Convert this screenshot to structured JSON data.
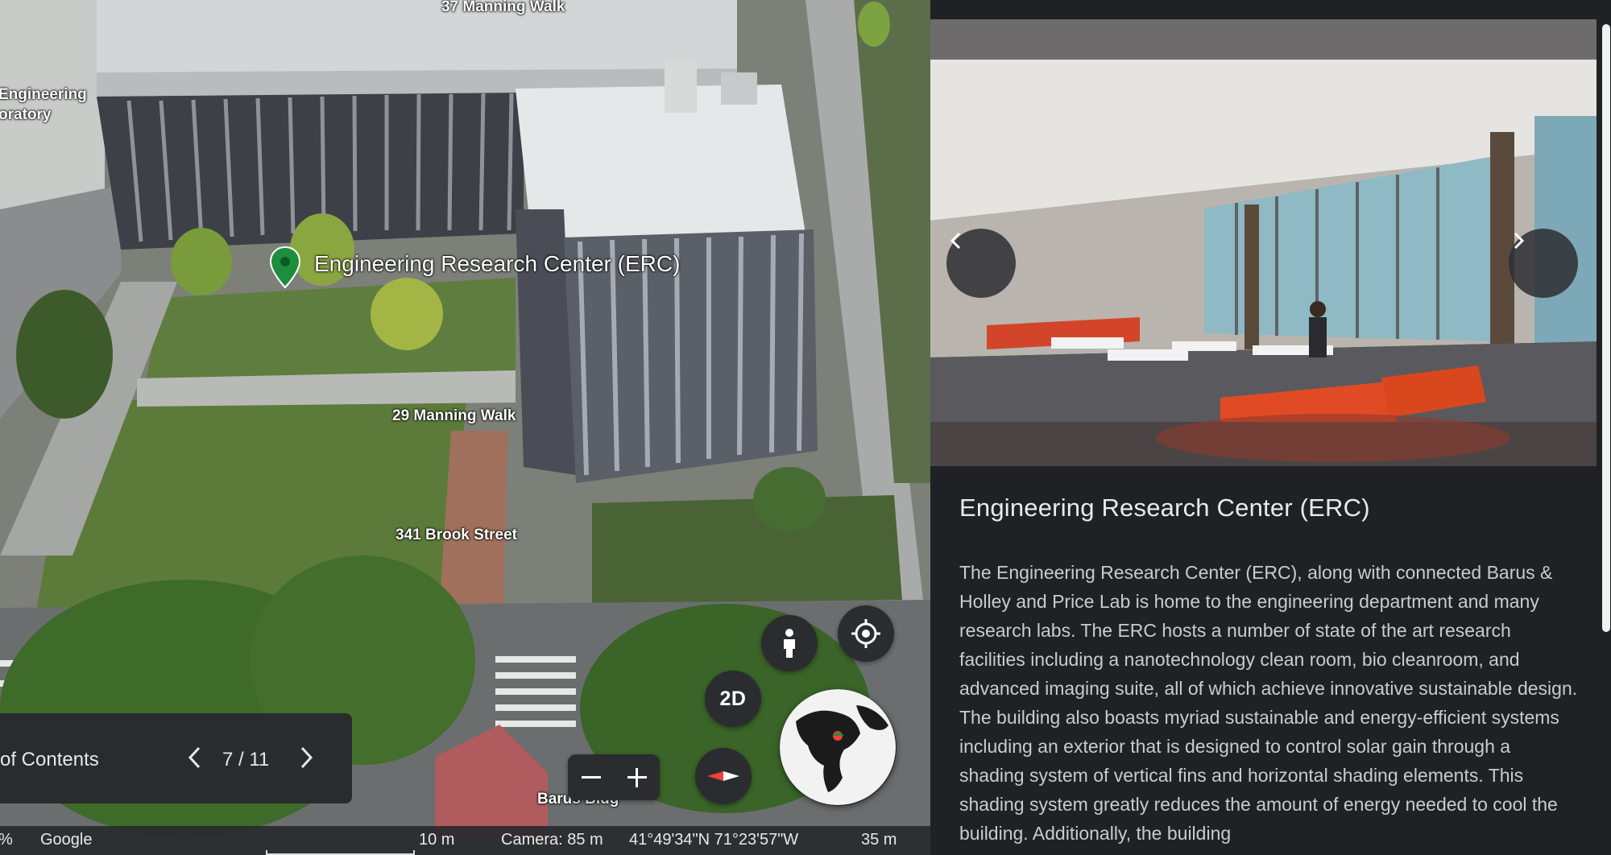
{
  "map": {
    "labels": {
      "top_street": "37 Manning Walk",
      "lab_line1": "Engineering",
      "lab_line2": "oratory",
      "poi": "Engineering Research Center (ERC)",
      "walk_29": "29 Manning Walk",
      "brook_341": "341 Brook Street",
      "barus": "Barus Bldg"
    },
    "controls": {
      "pegman_icon": "person-icon",
      "locate_icon": "my-location-icon",
      "view_toggle": "2D",
      "zoom_out_icon": "minus-icon",
      "zoom_in_icon": "plus-icon",
      "compass_icon": "compass-icon",
      "globe_icon": "globe-icon"
    },
    "colors": {
      "pin": "#1e8e3e",
      "compass_red": "#ea4335",
      "control_bg": "#2b2c2f"
    }
  },
  "toc": {
    "label": "of Contents",
    "count": "7 / 11"
  },
  "statusbar": {
    "zoom_pct": "%",
    "attribution": "Google",
    "scale": "10 m",
    "camera": "Camera: 85 m",
    "coords": "41°49'34\"N 71°23'57\"W",
    "elevation": "35 m"
  },
  "panel": {
    "title": "Engineering Research Center (ERC)",
    "description": "The Engineering Research Center (ERC), along with connected Barus & Holley and Price Lab is home to the engineering department and many research labs. The ERC hosts a number of state of the art research facilities including a nanotechnology clean room, bio cleanroom, and advanced imaging suite, all of which achieve innovative sustainable design. The building also boasts myriad sustainable and energy-efficient systems including an exterior that is designed to control solar gain through a shading system of vertical fins and horizontal shading elements. This shading system greatly reduces the amount of energy needed to cool the building. Additionally, the building",
    "carousel_prev_icon": "chevron-left-icon",
    "carousel_next_icon": "chevron-right-icon"
  }
}
